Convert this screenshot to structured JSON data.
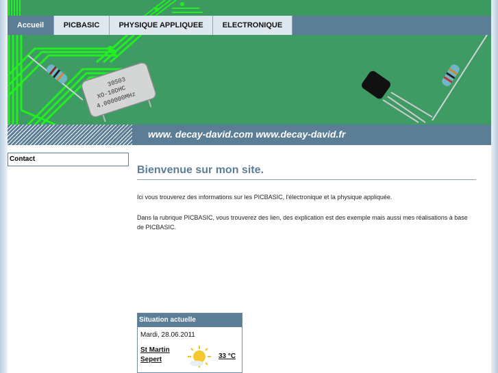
{
  "nav": {
    "items": [
      {
        "label": "Accueil",
        "active": true
      },
      {
        "label": "PICBASIC",
        "active": false
      },
      {
        "label": "PHYSIQUE APPLIQUEE",
        "active": false
      },
      {
        "label": "ELECTRONIQUE",
        "active": false
      }
    ]
  },
  "banner": {
    "url_text": "www. decay-david.com www.decay-david.fr",
    "oscillator_text_1": "30S03",
    "oscillator_text_2": "XO-10DHC",
    "oscillator_text_3": "4.000000MHz"
  },
  "sidebar": {
    "items": [
      {
        "label": "Contact"
      }
    ]
  },
  "main": {
    "title": "Bienvenue sur mon site.",
    "paragraphs": [
      "Ici vous  trouverez des informations sur les PICBASIC, l'électronique et la physique appliquée.",
      "Dans la rubrique PICBASIC, vous trouverez des lien, des explication est des exemple mais aussi mes réalisations à base de PICBASIC."
    ]
  },
  "weather": {
    "header": "Situation actuelle",
    "date": "Mardi, 28.06.2011",
    "city": "St Martin Sepert",
    "temperature": "33 °C",
    "icon": "sun-cloud-icon"
  },
  "colors": {
    "nav_blue": "#5b7e96",
    "board_green": "#3d9b63",
    "trace_green": "#22ee22"
  }
}
